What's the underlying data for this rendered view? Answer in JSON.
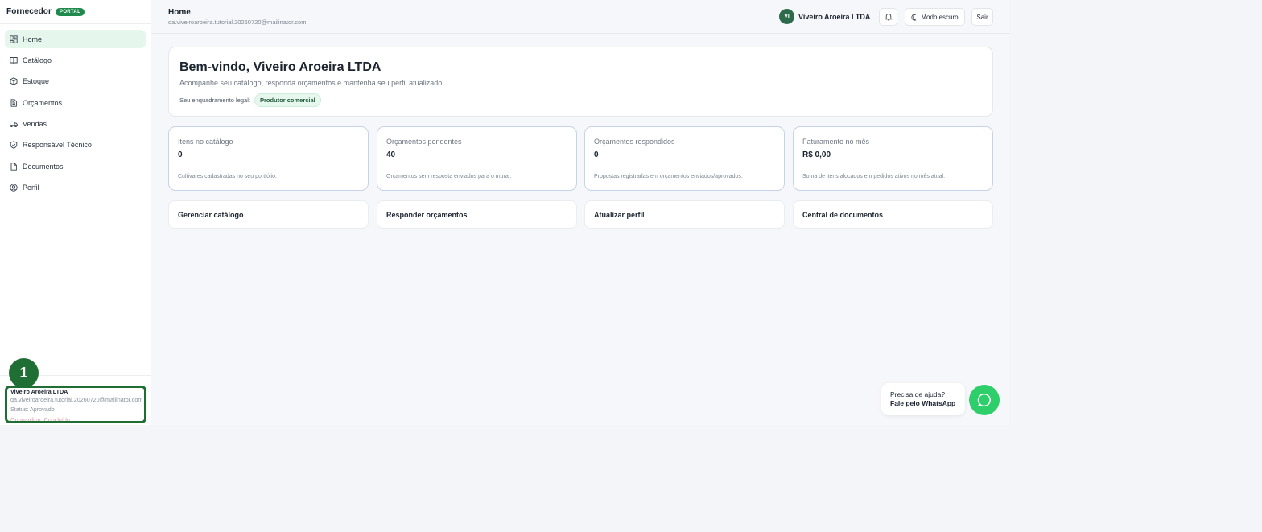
{
  "sidebar": {
    "brand": "Fornecedor",
    "badge": "PORTAL",
    "items": [
      {
        "label": "Home",
        "icon": "dashboard-icon",
        "active": true
      },
      {
        "label": "Catálogo",
        "icon": "book-open-icon"
      },
      {
        "label": "Estoque",
        "icon": "package-icon"
      },
      {
        "label": "Orçamentos",
        "icon": "file-text-icon"
      },
      {
        "label": "Vendas",
        "icon": "truck-icon"
      },
      {
        "label": "Responsável Técnico",
        "icon": "shield-check-icon"
      },
      {
        "label": "Documentos",
        "icon": "file-icon"
      },
      {
        "label": "Perfil",
        "icon": "user-circle-icon"
      }
    ],
    "user_card": {
      "name": "Viveiro Aroeira LTDA",
      "email": "qa.viveiroaroeira.tutorial.20260720@mailinator.com",
      "status": "Status: Aprovado",
      "onboarding": "Onboarding: Concluído"
    },
    "step_marker": "1"
  },
  "header": {
    "title": "Home",
    "subtitle": "qa.viveiroaroeira.tutorial.20260720@mailinator.com",
    "avatar_initials": "VI",
    "account_name": "Viveiro Aroeira LTDA",
    "notifications_icon": "bell-icon",
    "dark_mode_label": "Modo escuro",
    "dark_mode_icon": "moon-icon",
    "exit_label": "Sair"
  },
  "welcome": {
    "title": "Bem-vindo, Viveiro Aroeira LTDA",
    "subtitle": "Acompanhe seu catálogo, responda orçamentos e mantenha seu perfil atualizado.",
    "legal_label": "Seu enquadramento legal:",
    "legal_value": "Produtor comercial"
  },
  "stats": [
    {
      "label": "Itens no catálogo",
      "value": "0",
      "description": "Cultivares cadastradas no seu portfólio."
    },
    {
      "label": "Orçamentos pendentes",
      "value": "40",
      "description": "Orçamentos sem resposta enviados para o mural."
    },
    {
      "label": "Orçamentos respondidos",
      "value": "0",
      "description": "Propostas registradas em orçamentos enviados/aprovados."
    },
    {
      "label": "Faturamento no mês",
      "value": "R$ 0,00",
      "description": "Soma de itens alocados em pedidos ativos no mês atual."
    }
  ],
  "actions": [
    {
      "label": "Gerenciar catálogo"
    },
    {
      "label": "Responder orçamentos"
    },
    {
      "label": "Atualizar perfil"
    },
    {
      "label": "Central de documentos"
    }
  ],
  "help": {
    "line1": "Precisa de ajuda?",
    "line2": "Fale pelo WhatsApp",
    "icon": "whatsapp-icon",
    "accent": "#2ecf6a"
  },
  "colors": {
    "brand_green": "#1f8a4c",
    "active_nav_bg": "#e5f7ec",
    "highlight_border": "#1f6e34"
  }
}
